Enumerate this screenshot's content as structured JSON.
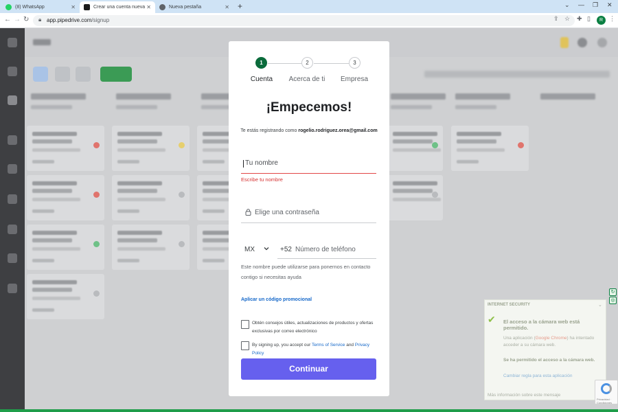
{
  "browser": {
    "tabs": [
      {
        "label": "(8) WhatsApp",
        "active": false
      },
      {
        "label": "Crear una cuenta nueva",
        "active": true
      },
      {
        "label": "Nueva pestaña",
        "active": false
      }
    ],
    "new_tab_icon": "plus-icon",
    "url_host": "app.pipedrive.com",
    "url_path": "/signup",
    "profile_initial": "R"
  },
  "signup": {
    "steps": [
      {
        "number": "1",
        "label": "Cuenta",
        "active": true
      },
      {
        "number": "2",
        "label": "Acerca de ti",
        "active": false
      },
      {
        "number": "3",
        "label": "Empresa",
        "active": false
      }
    ],
    "title": "¡Empecemos!",
    "registering_prefix": "Te estás registrando como",
    "email": "rogelio.rodriguez.orea@gmail.com",
    "name_placeholder": "Tu nombre",
    "name_error": "Escribe tu nombre",
    "password_placeholder": "Elige una contraseña",
    "country_code": "MX",
    "dial_prefix": "+52",
    "phone_placeholder": "Número de teléfono",
    "phone_help": "Este nombre puede utilizarse para ponernos en contacto contigo si necesitas ayuda",
    "promo_link": "Aplicar un código promocional",
    "newsletter_text": "Obtén consejos útiles, actualizaciones de productos y ofertas exclusivas por correo electrónico",
    "terms_prefix": "By signing up, you accept our",
    "terms_link": "Terms of Service",
    "terms_and": "and",
    "privacy_link": "Privacy Policy",
    "submit_label": "Continuar",
    "colors": {
      "accent": "#6660ee",
      "step_active": "#0a6b3b",
      "error": "#d63232"
    }
  },
  "eset": {
    "header": "INTERNET SECURITY",
    "message": "El acceso a la cámara web está permitido.",
    "detail_prefix": "Una aplicación (",
    "detail_app": "Google Chrome",
    "detail_suffix": ") ha intentado acceder a su cámara web.",
    "allowed": "Se ha permitido el acceso a la cámara web.",
    "rule_link": "Cambiar regla para esta aplicación",
    "footer": "Más información sobre este mensaje"
  },
  "recaptcha": {
    "text": "Privacidad · Condiciones"
  }
}
